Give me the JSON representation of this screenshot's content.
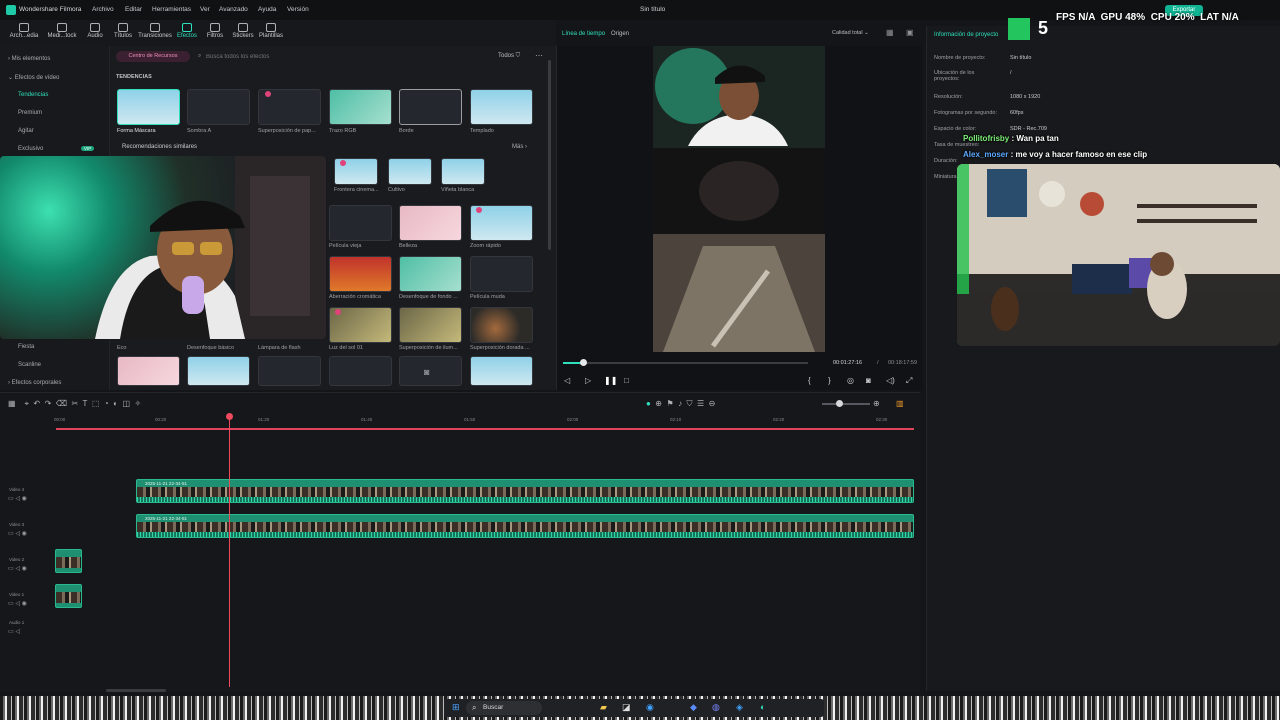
{
  "app": {
    "name": "Wondershare Filmora",
    "window_title": "Sin título",
    "export_label": "Exportar"
  },
  "menu": [
    "Archivo",
    "Editar",
    "Herramientas",
    "Ver",
    "Avanzado",
    "Ayuda",
    "Versión"
  ],
  "toolbar": [
    {
      "label": "Arch...edia",
      "icon": "media-icon"
    },
    {
      "label": "Medi...tock",
      "icon": "stock-icon"
    },
    {
      "label": "Audio",
      "icon": "audio-icon"
    },
    {
      "label": "Títulos",
      "icon": "titles-icon"
    },
    {
      "label": "Transiciones",
      "icon": "transitions-icon"
    },
    {
      "label": "Efectos",
      "icon": "effects-icon",
      "active": true
    },
    {
      "label": "Filtros",
      "icon": "filters-icon"
    },
    {
      "label": "Stickers",
      "icon": "stickers-icon"
    },
    {
      "label": "Plantillas",
      "icon": "templates-icon"
    }
  ],
  "sidebar": {
    "items": [
      "Mis elementos",
      "Efectos de vídeo",
      "Tendencias",
      "Premium",
      "Agitar",
      "Exclusivo",
      "Fiesta",
      "Scanline",
      "Efectos corporales"
    ],
    "exclusive_badge": "VIP"
  },
  "browser": {
    "resource_center": "Centro de Recursos",
    "search_placeholder": "Busca todos los efectos",
    "filter_label": "Todos",
    "section_trending": "TENDENCIAS",
    "row1": [
      "Forma Máscara",
      "Sombra A",
      "Superposición de pap...",
      "Trazo RGB",
      "Borde",
      "Templado"
    ],
    "similar_title": "Recomendaciones similares",
    "more_label": "Más",
    "similar": [
      "Frontera cinema...",
      "Cultivo",
      "Viñeta blanca"
    ],
    "grid": [
      [
        "Película vieja",
        "Belleza",
        "Zoom rápido"
      ],
      [
        "Aberración cromática",
        "Desenfoque de fondo ...",
        "Película muda"
      ],
      [
        "Luz del sol 01",
        "Superposición de ilum...",
        "Superposición dorada ..."
      ]
    ],
    "bottom_row": [
      "Eco",
      "Desenfoque básico",
      "Lámpara de flash"
    ]
  },
  "preview": {
    "tab_timeline": "Línea de tiempo",
    "tab_source": "Origen",
    "quality": "Calidad total",
    "time_current": "00:01:27:16",
    "time_sep": "/",
    "time_total": "00:18:17:59",
    "progress": 0.08
  },
  "project_info": {
    "title": "Información de proyecto",
    "rows": [
      {
        "k": "Nombre de proyecto:",
        "v": "Sin título"
      },
      {
        "k": "Ubicación de los proyectos:",
        "v": "/"
      },
      {
        "k": "Resolución:",
        "v": "1080 x 1920"
      },
      {
        "k": "Fotogramas por segundo:",
        "v": "60fps"
      },
      {
        "k": "Espacio de color:",
        "v": "SDR - Rec.709"
      },
      {
        "k": "Tasa de muestreo:",
        "v": ""
      },
      {
        "k": "Duración:",
        "v": ""
      },
      {
        "k": "Miniatura:",
        "v": ""
      }
    ]
  },
  "overlay": {
    "hud": {
      "fps_label": "FPS",
      "fps_value": "N/A",
      "gpu_label": "GPU",
      "gpu_value": "48%",
      "cpu_label": "CPU",
      "cpu_value": "20%",
      "lat_label": "LAT",
      "lat_value": "N/A",
      "k_number": "5"
    },
    "chat": [
      {
        "user": "Pollitofrisby",
        "sep": ":",
        "msg": "Wan pa tan",
        "color": "#7ef07a"
      },
      {
        "user": "Alex_moser",
        "sep": ":",
        "msg": "me voy a hacer famoso en ese clip",
        "color": "#5da9ff"
      }
    ]
  },
  "timeline": {
    "ruler": [
      "00:00",
      "00:20",
      "01:20",
      "01:40",
      "01:50",
      "02:00",
      "02:10",
      "02:20",
      "02:30"
    ],
    "tracks": [
      "Video 4",
      "Video 3",
      "Video 2",
      "Video 1",
      "Audio 1"
    ],
    "clip_names": [
      "2025-11-21 22-34-51",
      "2025-11-21 22-34-51"
    ]
  },
  "taskbar": {
    "search_label": "Buscar"
  }
}
